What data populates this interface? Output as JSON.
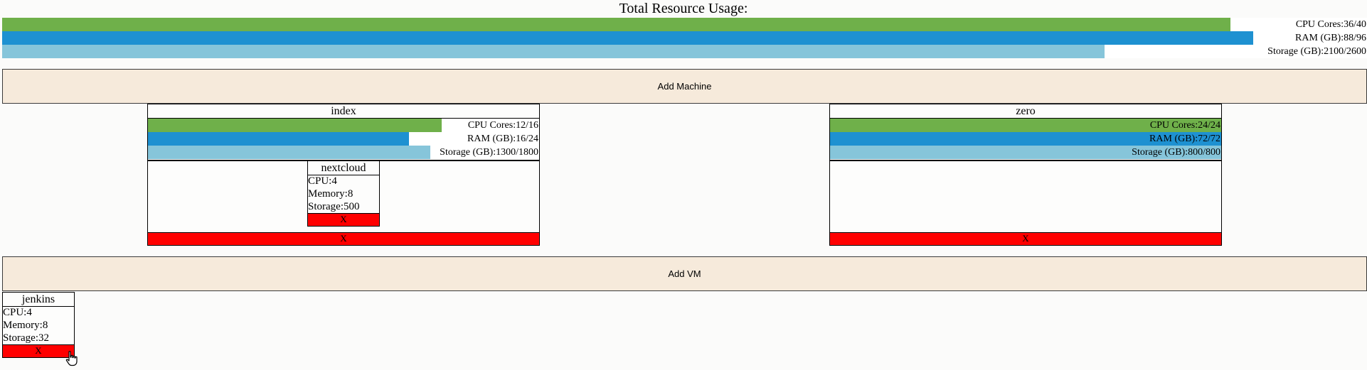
{
  "colors": {
    "cpu": "#6fb04a",
    "ram": "#1e91d1",
    "storage": "#86c5da",
    "delete": "#ff0000",
    "add_button": "#f6eadb"
  },
  "total": {
    "title": "Total Resource Usage:",
    "cpu": {
      "label": "CPU Cores:36/40",
      "fraction": 0.9
    },
    "ram": {
      "label": "RAM (GB):88/96",
      "fraction": 0.9167
    },
    "storage": {
      "label": "Storage (GB):2100/2600",
      "fraction": 0.8077
    }
  },
  "add_machine_label": "Add Machine",
  "machines": [
    {
      "name": "index",
      "cpu": {
        "label": "CPU Cores:12/16",
        "fraction": 0.75
      },
      "ram": {
        "label": "RAM (GB):16/24",
        "fraction": 0.6667
      },
      "storage": {
        "label": "Storage (GB):1300/1800",
        "fraction": 0.7222
      },
      "vm": {
        "name": "nextcloud",
        "cpu": "CPU:4",
        "memory": "Memory:8",
        "storage": "Storage:500",
        "delete_label": "X"
      },
      "delete_label": "X"
    },
    {
      "name": "zero",
      "cpu": {
        "label": "CPU Cores:24/24",
        "fraction": 1
      },
      "ram": {
        "label": "RAM (GB):72/72",
        "fraction": 1
      },
      "storage": {
        "label": "Storage (GB):800/800",
        "fraction": 1
      },
      "delete_label": "X"
    }
  ],
  "add_vm_label": "Add VM",
  "unassigned_vms": [
    {
      "name": "jenkins",
      "cpu": "CPU:4",
      "memory": "Memory:8",
      "storage": "Storage:32",
      "delete_label": "X"
    }
  ],
  "icons": {
    "cursor": "hand-pointer-icon"
  }
}
